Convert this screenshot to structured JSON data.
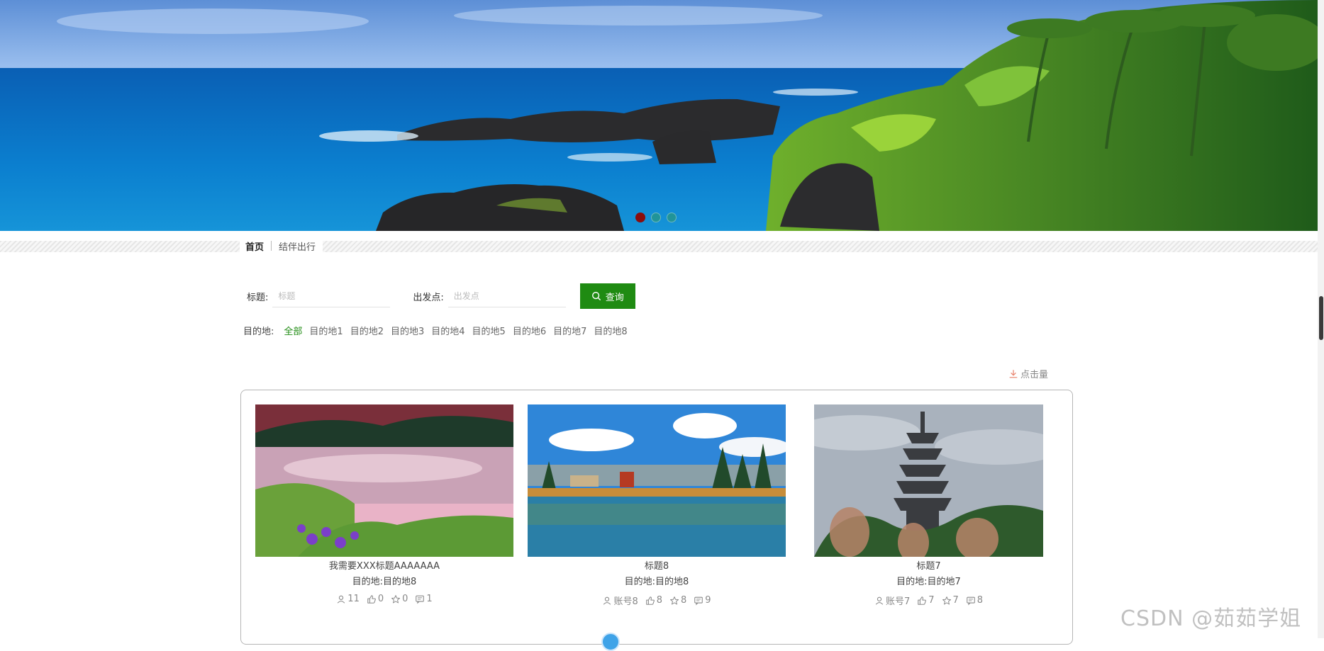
{
  "banner": {
    "slides": 3,
    "active_slide": 1,
    "dots": [
      {
        "state": "active"
      },
      {
        "state": "inactive"
      },
      {
        "state": "inactive"
      }
    ]
  },
  "nav": {
    "home": "首页",
    "current": "结伴出行"
  },
  "search": {
    "title_label": "标题:",
    "title_placeholder": "标题",
    "title_value": "",
    "origin_label": "出发点:",
    "origin_placeholder": "出发点",
    "origin_value": "",
    "button_label": "查询",
    "button_icon": "search-icon"
  },
  "filter": {
    "label": "目的地:",
    "items": [
      "全部",
      "目的地1",
      "目的地2",
      "目的地3",
      "目的地4",
      "目的地5",
      "目的地6",
      "目的地7",
      "目的地8"
    ],
    "active_index": 0
  },
  "sort": {
    "label": "点击量",
    "icon": "download-icon"
  },
  "cards": [
    {
      "title": "我需要XXX标题AAAAAAA",
      "dest": "目的地:目的地8",
      "user": "",
      "views": "11",
      "likes": "0",
      "favs": "0",
      "comments": "1"
    },
    {
      "title": "标题8",
      "dest": "目的地:目的地8",
      "user": "账号8",
      "views": "",
      "likes": "8",
      "favs": "8",
      "comments": "9"
    },
    {
      "title": "标题7",
      "dest": "目的地:目的地7",
      "user": "账号7",
      "views": "",
      "likes": "7",
      "favs": "7",
      "comments": "8"
    }
  ],
  "watermark": "CSDN @茹茹学姐",
  "colors": {
    "accent": "#1f8b12",
    "active_dot": "#8b0d0d",
    "pager": "#3fa3e8"
  }
}
